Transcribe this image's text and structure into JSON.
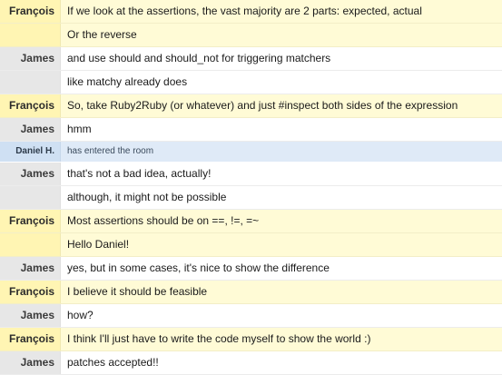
{
  "messages": [
    {
      "author": "François",
      "text": "If we look at the assertions, the vast majority are 2 parts: expected, actual",
      "kind": "me"
    },
    {
      "author": "",
      "text": "Or the reverse",
      "kind": "me"
    },
    {
      "author": "James",
      "text": "and use should and should_not for triggering matchers",
      "kind": "other"
    },
    {
      "author": "",
      "text": "like matchy already does",
      "kind": "other"
    },
    {
      "author": "François",
      "text": "So, take Ruby2Ruby (or whatever) and just #inspect both sides of the expression",
      "kind": "me"
    },
    {
      "author": "James",
      "text": "hmm",
      "kind": "other"
    },
    {
      "author": "Daniel H.",
      "text": "has entered the room",
      "kind": "enter"
    },
    {
      "author": "James",
      "text": "that's not a bad idea, actually!",
      "kind": "other"
    },
    {
      "author": "",
      "text": "although, it might not be possible",
      "kind": "other"
    },
    {
      "author": "François",
      "text": "Most assertions should be on ==, !=, =~",
      "kind": "me"
    },
    {
      "author": "",
      "text": "Hello Daniel!",
      "kind": "me"
    },
    {
      "author": "James",
      "text": "yes, but in some cases, it's nice to show the difference",
      "kind": "other"
    },
    {
      "author": "François",
      "text": "I believe it should be feasible",
      "kind": "me"
    },
    {
      "author": "James",
      "text": "how?",
      "kind": "other"
    },
    {
      "author": "François",
      "text": "I think I'll just have to write the code myself to show the world :)",
      "kind": "me"
    },
    {
      "author": "James",
      "text": "patches accepted!!",
      "kind": "other"
    }
  ],
  "colors": {
    "self_row": "#fffbd6",
    "self_author": "#fff5b3",
    "other_author": "#e7e7e7",
    "enter_row": "#dfeaf7"
  }
}
